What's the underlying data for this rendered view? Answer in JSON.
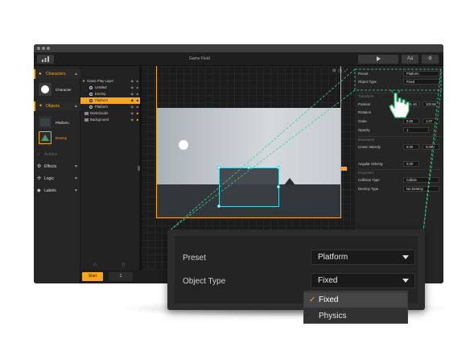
{
  "window": {
    "title": "Game Field"
  },
  "toolbar": {
    "play_icon": "play-icon",
    "text_icon": "Aa",
    "settings_icon": "gear-icon"
  },
  "left_panel": {
    "characters_header": "Characters",
    "character_label": "Character",
    "objects_header": "Objects",
    "platform_label": "Platform",
    "enemy_label": "Enemy",
    "actions_header": "Actions",
    "effects_header": "Effects",
    "logic_header": "Logic",
    "labels_header": "Labels"
  },
  "layers": [
    {
      "name": "Game Play Layer"
    },
    {
      "name": "Untitled"
    },
    {
      "name": "Enemy"
    },
    {
      "name": "Platform"
    },
    {
      "name": "Platform"
    },
    {
      "name": "DarkClouds"
    },
    {
      "name": "Background"
    }
  ],
  "properties": {
    "preset_label": "Preset",
    "preset_value": "Platform",
    "object_type_label": "Object Type",
    "object_type_value": "Fixed",
    "transform_section": "Transform",
    "position_label": "Position",
    "position_x": "181.46",
    "position_y": "102.58",
    "rotation_label": "Rotation",
    "scale_label": "Scale",
    "scale_x": "0.60",
    "scale_y": "1.07",
    "opacity_label": "Opacity",
    "opacity_value": "1",
    "movement_section": "Movement",
    "linear_velocity_label": "Linear Velocity",
    "lv_x": "0.00",
    "lv_y": "0.00",
    "angular_velocity_label": "Angular Velocity",
    "av_value": "0.00",
    "properties_section": "Properties",
    "collision_type_label": "Collision Type",
    "collision_type_value": "Collide",
    "destroy_type_label": "Destroy Type",
    "destroy_type_value": "No Destroy"
  },
  "bottom": {
    "start_label": "Start",
    "page_label": "1"
  },
  "zoom_panel": {
    "preset_label": "Preset",
    "preset_value": "Platform",
    "object_type_label": "Object Type",
    "object_type_value": "Fixed",
    "options": [
      "Fixed",
      "Physics"
    ],
    "selected_option": "Fixed"
  },
  "colors": {
    "accent": "#f5a623",
    "selection": "#4fd1e0",
    "guide": "#3ecf8e"
  }
}
